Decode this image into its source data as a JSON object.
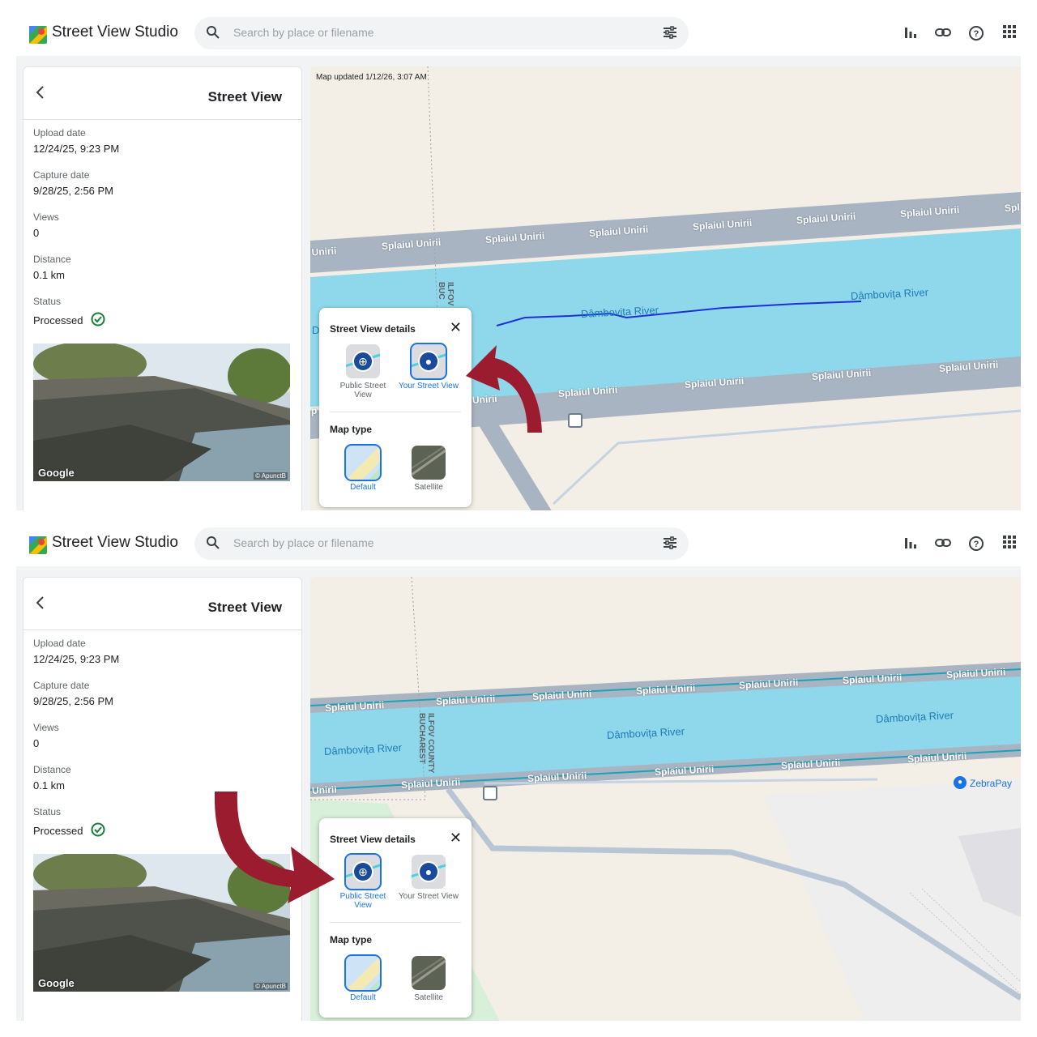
{
  "panels": [
    {
      "app": {
        "brand": "Street View Studio",
        "search_placeholder": "Search by place or filename"
      },
      "detail": {
        "title": "Street View",
        "upload_label": "Upload date",
        "upload_value": "12/24/25, 9:23 PM",
        "capture_label": "Capture date",
        "capture_value": "9/28/25, 2:56 PM",
        "views_label": "Views",
        "views_value": "0",
        "distance_label": "Distance",
        "distance_value": "0.1 km",
        "status_label": "Status",
        "status_value": "Processed",
        "photo_watermark": "Google",
        "photo_credit": "© ApunctB"
      },
      "map": {
        "updated": "Map updated 1/12/26, 3:07 AM",
        "road_labels": [
          "l Unirii",
          "Splaiul Unirii",
          "Splaiul Unirii",
          "Splaiul Unirii",
          "Splaiul Unirii",
          "Splaiul Unirii",
          "Splaiul Unirii",
          "Spl"
        ],
        "road_labels_lower": [
          "Unirii",
          "Splaiul Unirii",
          "Splaiul Unirii",
          "Splaiul Unirii",
          "Splaiul Unirii"
        ],
        "river_labels": [
          "Dâmbovița River",
          "Dâmbovița River",
          "D"
        ],
        "county_label": "ILFOV\nBUC",
        "partial_label": "p"
      },
      "popup": {
        "title": "Street View details",
        "public_label": "Public Street View",
        "yours_label": "Your Street View",
        "selected": "yours",
        "map_type_label": "Map type",
        "default_label": "Default",
        "satellite_label": "Satellite"
      }
    },
    {
      "app": {
        "brand": "Street View Studio",
        "search_placeholder": "Search by place or filename"
      },
      "detail": {
        "title": "Street View",
        "upload_label": "Upload date",
        "upload_value": "12/24/25, 9:23 PM",
        "capture_label": "Capture date",
        "capture_value": "9/28/25, 2:56 PM",
        "views_label": "Views",
        "views_value": "0",
        "distance_label": "Distance",
        "distance_value": "0.1 km",
        "status_label": "Status",
        "status_value": "Processed",
        "photo_watermark": "Google",
        "photo_credit": "© ApunctB"
      },
      "map": {
        "road_labels": [
          "Splaiul Unirii",
          "Splaiul Unirii",
          "Splaiul Unirii",
          "Splaiul Unirii",
          "Splaiul Unirii",
          "Splaiul Unirii",
          "Splaiul Unirii"
        ],
        "road_labels_lower": [
          "Unirii",
          "Splaiul Unirii",
          "Splaiul Unirii",
          "Splaiul Unirii",
          "Splaiul Unirii",
          "Splaiul Unirii"
        ],
        "river_labels": [
          "Dâmbovița River",
          "Dâmbovița River",
          "Dâmbovița River"
        ],
        "county_label": "ILFOV COUNTY\nBUCHAREST",
        "poi": "ZebraPay"
      },
      "popup": {
        "title": "Street View details",
        "public_label": "Public Street View",
        "yours_label": "Your Street View",
        "selected": "public",
        "map_type_label": "Map type",
        "default_label": "Default",
        "satellite_label": "Satellite"
      }
    }
  ],
  "colors": {
    "water": "#8fd8ec",
    "road": "#a9b4c2",
    "land": "#f3efe7",
    "highlight_arrow": "#9b1c2e",
    "accent": "#1a73e8"
  },
  "icons": [
    "google-maps-logo-icon",
    "search-icon",
    "tune-icon",
    "bar-chart-icon",
    "link-icon",
    "help-icon",
    "apps-grid-icon",
    "back-arrow-icon",
    "check-circle-icon",
    "close-icon",
    "globe-icon",
    "person-icon"
  ]
}
